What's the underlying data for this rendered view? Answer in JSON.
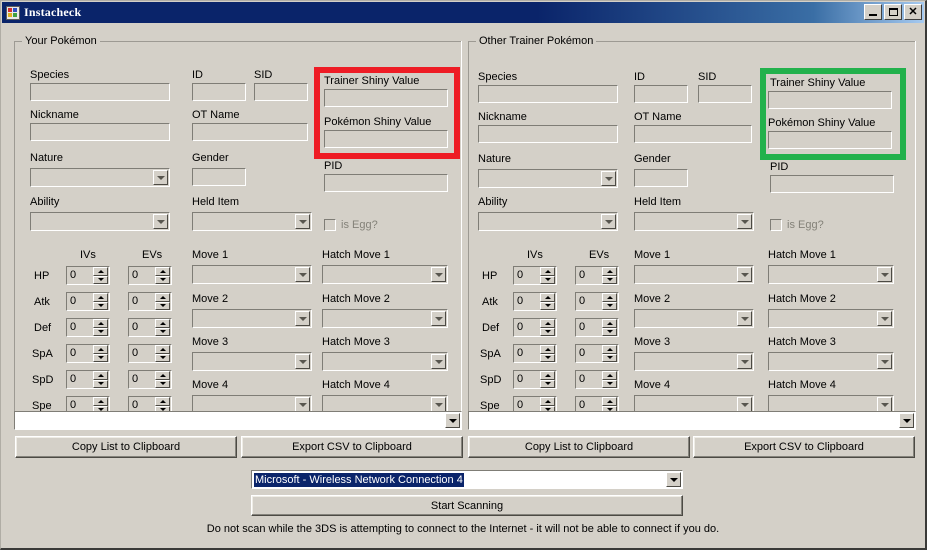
{
  "window": {
    "title": "Instacheck",
    "icon": "app-icon",
    "controls": {
      "minimize": "minimize-button",
      "maximize": "maximize-button",
      "close": "close-button"
    }
  },
  "colors": {
    "face": "#d4d0c8",
    "title_start": "#0a246a",
    "title_end": "#a6caf0",
    "highlight_your": "#ee1c25",
    "highlight_other": "#22b14c",
    "selection": "#0a246a",
    "disabled_text": "#848279"
  },
  "panels": [
    {
      "id": "your",
      "legend": "Your Pokémon",
      "highlight_color": "#ee1c25",
      "fields": {
        "species_label": "Species",
        "species_value": "",
        "nickname_label": "Nickname",
        "nickname_value": "",
        "nature_label": "Nature",
        "nature_value": "",
        "ability_label": "Ability",
        "ability_value": "",
        "id_label": "ID",
        "id_value": "",
        "sid_label": "SID",
        "sid_value": "",
        "ot_name_label": "OT Name",
        "ot_name_value": "",
        "gender_label": "Gender",
        "gender_value": "",
        "held_item_label": "Held Item",
        "held_item_value": "",
        "trainer_sv_label": "Trainer Shiny Value",
        "trainer_sv_value": "",
        "pokemon_sv_label": "Pokémon Shiny Value",
        "pokemon_sv_value": "",
        "pid_label": "PID",
        "pid_value": "",
        "is_egg_label": "is Egg?",
        "is_egg_checked": false
      },
      "stats": {
        "ivs_header": "IVs",
        "evs_header": "EVs",
        "rows": [
          {
            "name": "HP",
            "iv": "0",
            "ev": "0"
          },
          {
            "name": "Atk",
            "iv": "0",
            "ev": "0"
          },
          {
            "name": "Def",
            "iv": "0",
            "ev": "0"
          },
          {
            "name": "SpA",
            "iv": "0",
            "ev": "0"
          },
          {
            "name": "SpD",
            "iv": "0",
            "ev": "0"
          },
          {
            "name": "Spe",
            "iv": "0",
            "ev": "0"
          }
        ]
      },
      "moves": [
        {
          "label": "Move 1",
          "value": ""
        },
        {
          "label": "Move 2",
          "value": ""
        },
        {
          "label": "Move 3",
          "value": ""
        },
        {
          "label": "Move 4",
          "value": ""
        }
      ],
      "hatch_moves": [
        {
          "label": "Hatch Move 1",
          "value": ""
        },
        {
          "label": "Hatch Move 2",
          "value": ""
        },
        {
          "label": "Hatch Move 3",
          "value": ""
        },
        {
          "label": "Hatch Move 4",
          "value": ""
        }
      ],
      "results_combo_value": "",
      "copy_button": "Copy List to Clipboard",
      "export_button": "Export CSV to Clipboard"
    },
    {
      "id": "other",
      "legend": "Other Trainer Pokémon",
      "highlight_color": "#22b14c",
      "fields": {
        "species_label": "Species",
        "species_value": "",
        "nickname_label": "Nickname",
        "nickname_value": "",
        "nature_label": "Nature",
        "nature_value": "",
        "ability_label": "Ability",
        "ability_value": "",
        "id_label": "ID",
        "id_value": "",
        "sid_label": "SID",
        "sid_value": "",
        "ot_name_label": "OT Name",
        "ot_name_value": "",
        "gender_label": "Gender",
        "gender_value": "",
        "held_item_label": "Held Item",
        "held_item_value": "",
        "trainer_sv_label": "Trainer Shiny Value",
        "trainer_sv_value": "",
        "pokemon_sv_label": "Pokémon Shiny Value",
        "pokemon_sv_value": "",
        "pid_label": "PID",
        "pid_value": "",
        "is_egg_label": "is Egg?",
        "is_egg_checked": false
      },
      "stats": {
        "ivs_header": "IVs",
        "evs_header": "EVs",
        "rows": [
          {
            "name": "HP",
            "iv": "0",
            "ev": "0"
          },
          {
            "name": "Atk",
            "iv": "0",
            "ev": "0"
          },
          {
            "name": "Def",
            "iv": "0",
            "ev": "0"
          },
          {
            "name": "SpA",
            "iv": "0",
            "ev": "0"
          },
          {
            "name": "SpD",
            "iv": "0",
            "ev": "0"
          },
          {
            "name": "Spe",
            "iv": "0",
            "ev": "0"
          }
        ]
      },
      "moves": [
        {
          "label": "Move 1",
          "value": ""
        },
        {
          "label": "Move 2",
          "value": ""
        },
        {
          "label": "Move 3",
          "value": ""
        },
        {
          "label": "Move 4",
          "value": ""
        }
      ],
      "hatch_moves": [
        {
          "label": "Hatch Move 1",
          "value": ""
        },
        {
          "label": "Hatch Move 2",
          "value": ""
        },
        {
          "label": "Hatch Move 3",
          "value": ""
        },
        {
          "label": "Hatch Move 4",
          "value": ""
        }
      ],
      "results_combo_value": "",
      "copy_button": "Copy List to Clipboard",
      "export_button": "Export CSV to Clipboard"
    }
  ],
  "footer": {
    "adapter_value": "Microsoft - Wireless Network Connection 4",
    "scan_button": "Start Scanning",
    "warning": "Do not scan while the 3DS is attempting to connect to the Internet - it will not be able to connect if you do."
  }
}
